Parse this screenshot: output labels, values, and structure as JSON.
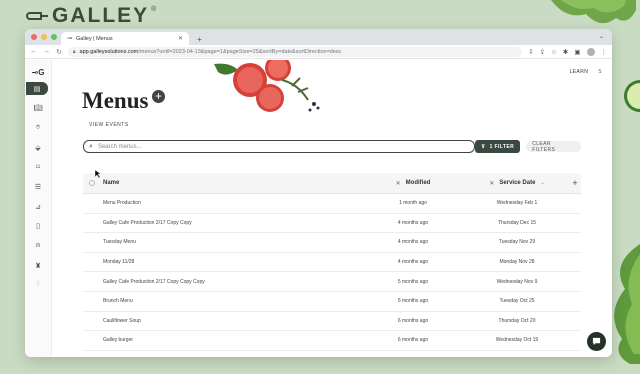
{
  "brand": {
    "name": "GALLEY",
    "reg": "®"
  },
  "browser": {
    "tab_title": "Galley | Menus",
    "url_domain": "app.galleysolutions.com",
    "url_path": "/menus?until=2023-04-13&page=1&pageSize=25&sortBy=date&sortDirection=desc"
  },
  "header": {
    "learn": "LEARN",
    "user_initial": "S"
  },
  "page": {
    "title": "Menus",
    "add_symbol": "+",
    "view_events": "VIEW EVENTS"
  },
  "search": {
    "placeholder": "Search menus...",
    "filter_label": "1 FILTER",
    "clear_label": "CLEAR FILTERS"
  },
  "table": {
    "columns": {
      "name": "Name",
      "modified": "Modified",
      "service_date": "Service Date"
    },
    "rows": [
      {
        "name": "Menu Production",
        "modified": "1 month ago",
        "service_date": "Wednesday Feb 1"
      },
      {
        "name": "Galley Cafe Production 2/17 Copy Copy",
        "modified": "4 months ago",
        "service_date": "Thursday Dec 15"
      },
      {
        "name": "Tuesday Menu",
        "modified": "4 months ago",
        "service_date": "Tuesday Nov 29"
      },
      {
        "name": "Monday 11/28",
        "modified": "4 months ago",
        "service_date": "Monday Nov 28"
      },
      {
        "name": "Galley Cafe Production 2/17 Copy Copy Copy",
        "modified": "5 months ago",
        "service_date": "Wednesday Nov 9"
      },
      {
        "name": "Brunch Menu",
        "modified": "5 months ago",
        "service_date": "Tuesday Oct 25"
      },
      {
        "name": "Cauliflower Soup",
        "modified": "6 months ago",
        "service_date": "Thursday Oct 20"
      },
      {
        "name": "Galley burger",
        "modified": "6 months ago",
        "service_date": "Wednesday Oct 19"
      }
    ]
  },
  "colors": {
    "accent": "#3b4840",
    "background": "#c9dcc3"
  }
}
